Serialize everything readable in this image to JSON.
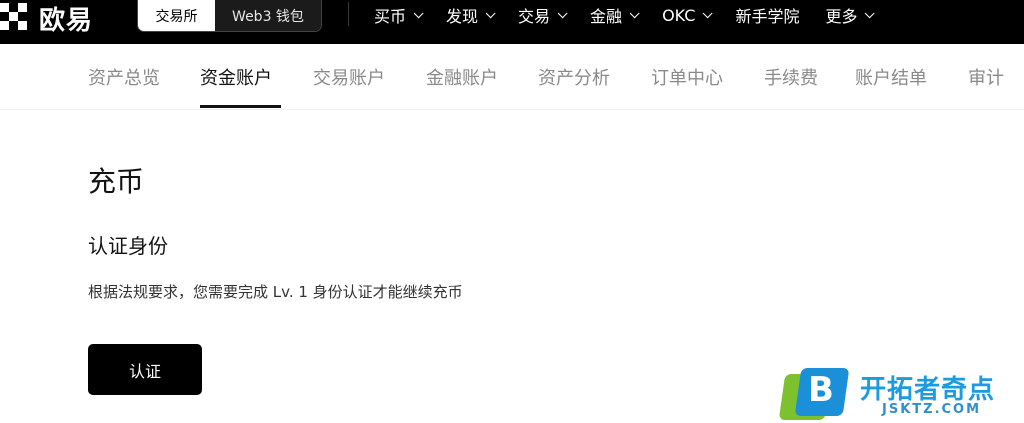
{
  "header": {
    "logo_text": "欧易",
    "switch": {
      "exchange": "交易所",
      "web3": "Web3 钱包"
    },
    "nav": [
      {
        "label": "买币",
        "has_dropdown": true
      },
      {
        "label": "发现",
        "has_dropdown": true
      },
      {
        "label": "交易",
        "has_dropdown": true
      },
      {
        "label": "金融",
        "has_dropdown": true
      },
      {
        "label": "OKC",
        "has_dropdown": true
      },
      {
        "label": "新手学院",
        "has_dropdown": false
      },
      {
        "label": "更多",
        "has_dropdown": true
      }
    ]
  },
  "subnav": {
    "items": [
      {
        "label": "资产总览",
        "active": false
      },
      {
        "label": "资金账户",
        "active": true
      },
      {
        "label": "交易账户",
        "active": false
      },
      {
        "label": "金融账户",
        "active": false
      },
      {
        "label": "资产分析",
        "active": false
      },
      {
        "label": "订单中心",
        "active": false
      },
      {
        "label": "手续费",
        "active": false
      },
      {
        "label": "账户结单",
        "active": false
      },
      {
        "label": "审计",
        "active": false
      }
    ]
  },
  "content": {
    "page_title": "充币",
    "section_title": "认证身份",
    "description": "根据法规要求，您需要完成 Lv. 1 身份认证才能继续充币",
    "verify_button": "认证"
  },
  "watermark": {
    "badge_letter": "B",
    "name": "开拓者奇点",
    "url": "JSKTZ.COM"
  },
  "colors": {
    "header_bg": "#000000",
    "active_text": "#121212",
    "inactive_text": "#8a8a8a",
    "button_bg": "#000000",
    "watermark_blue": "#1b8fd8",
    "watermark_green": "#7ec12f"
  }
}
